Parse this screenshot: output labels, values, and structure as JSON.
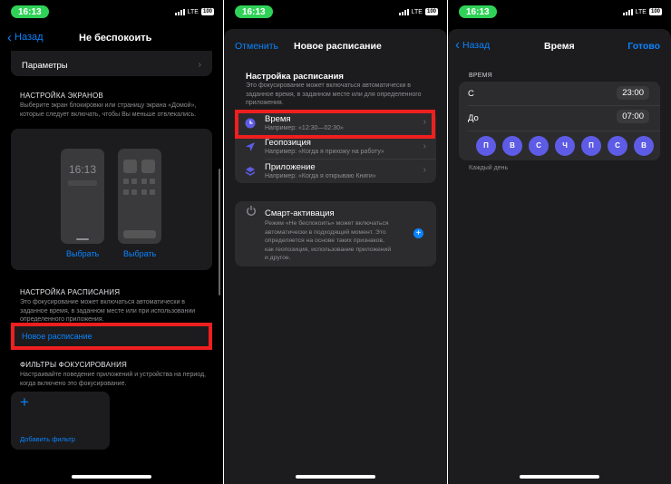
{
  "status": {
    "time": "16:13",
    "network": "LTE",
    "battery": "100"
  },
  "screen1": {
    "nav": {
      "back": "Назад",
      "title": "Не беспокоить"
    },
    "params_label": "Параметры",
    "screens_header": "НАСТРОЙКА ЭКРАНОВ",
    "screens_desc": "Выберите экран блокировки или страницу экрана «Домой», которые следует включать, чтобы Вы меньше отвлекались.",
    "lock_time": "16:13",
    "choose1": "Выбрать",
    "choose2": "Выбрать",
    "schedule_header": "НАСТРОЙКА РАСПИСАНИЯ",
    "schedule_desc": "Это фокусирование может включаться автоматически в заданное время, в заданном месте или при использовании определенного приложения.",
    "new_schedule": "Новое расписание",
    "filters_header": "ФИЛЬТРЫ ФОКУСИРОВАНИЯ",
    "filters_desc": "Настраивайте поведение приложений и устройства на период, когда включено это фокусирование.",
    "add_filter": "Добавить фильтр"
  },
  "screen2": {
    "nav": {
      "cancel": "Отменить",
      "title": "Новое расписание"
    },
    "section_title": "Настройка расписания",
    "section_desc": "Это фокусирование может включаться автоматически в заданное время, в заданном месте или для определенного приложения.",
    "items": [
      {
        "title": "Время",
        "subtitle": "Например: «12:30—02:30»",
        "icon": "clock-icon",
        "color": "#5e5ce6"
      },
      {
        "title": "Геопозиция",
        "subtitle": "Например: «Когда я прихожу на работу»",
        "icon": "location-arrow-icon",
        "color": "#5e5ce6"
      },
      {
        "title": "Приложение",
        "subtitle": "Например: «Когда я открываю Книги»",
        "icon": "layers-icon",
        "color": "#5e5ce6"
      }
    ],
    "smart": {
      "title": "Смарт-активация",
      "desc": "Режим «Не беспокоить» может включаться автоматически в подходящий момент. Это определяется на основе таких признаков, как геопозиция, использование приложений и другое."
    }
  },
  "screen3": {
    "nav": {
      "back": "Назад",
      "title": "Время",
      "done": "Готово"
    },
    "section": "ВРЕМЯ",
    "from_label": "С",
    "from_value": "23:00",
    "to_label": "До",
    "to_value": "07:00",
    "days": [
      "П",
      "В",
      "С",
      "Ч",
      "П",
      "С",
      "В"
    ],
    "footer": "Каждый день"
  },
  "colors": {
    "accent": "#0a84ff",
    "highlight": "#f01f1f",
    "day_circle": "#5e5ce6",
    "status_pill": "#30d158"
  }
}
